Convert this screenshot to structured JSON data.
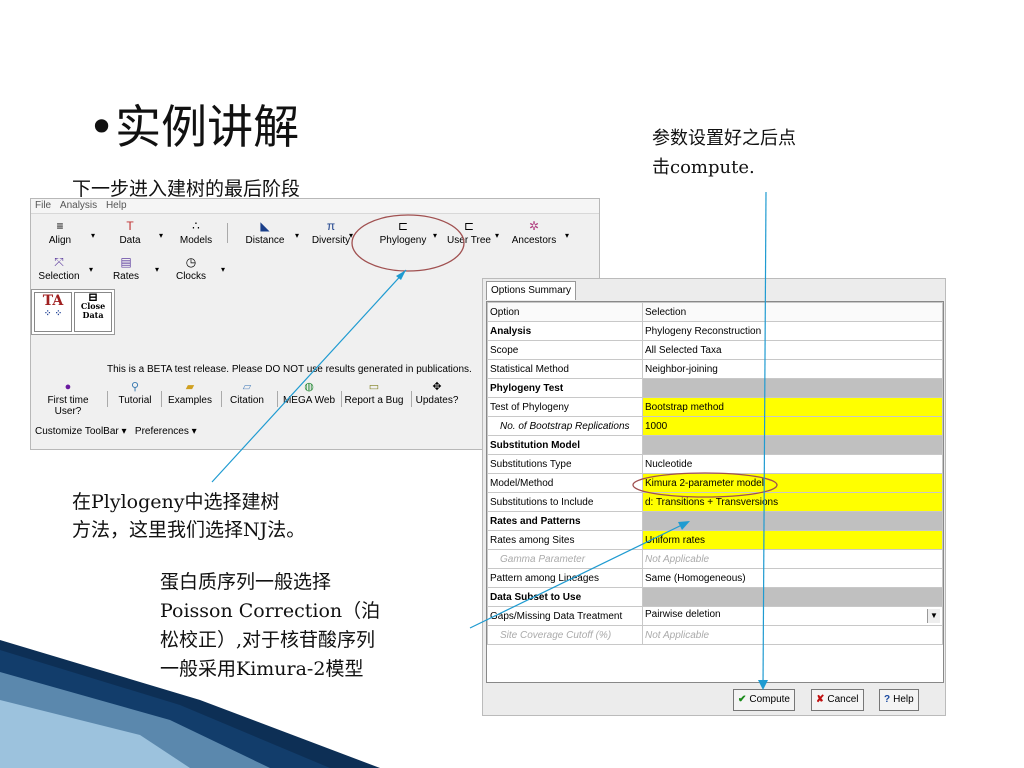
{
  "slide": {
    "title": "•实例讲解",
    "subtitle": "下一步进入建树的最后阶段",
    "note_right": [
      "参数设置好之后点",
      "击compute."
    ],
    "note_left": [
      "在Plylogeny中选择建树",
      "方法，这里我们选择NJ法。"
    ],
    "note_bottom": [
      "蛋白质序列一般选择",
      "Poisson Correction（泊",
      "松校正）,对于核苷酸序列",
      "一般采用Kimura-2模型"
    ]
  },
  "mega": {
    "menu": [
      "File",
      "Analysis",
      "Help"
    ],
    "toolbar_row1": [
      "Align",
      "Data",
      "Models",
      "Distance",
      "Diversity",
      "Phylogeny",
      "User Tree",
      "Ancestors"
    ],
    "toolbar_row2": [
      "Selection",
      "Rates",
      "Clocks"
    ],
    "close_data": "Close Data",
    "ta_label": "TA",
    "beta_notice": "This is a BETA test release. Please DO NOT use results generated in publications.",
    "links": [
      "First time User?",
      "Tutorial",
      "Examples",
      "Citation",
      "MEGA Web",
      "Report a Bug",
      "Updates?"
    ],
    "customize": "Customize ToolBar",
    "preferences": "Preferences"
  },
  "dialog": {
    "tab": "Options Summary",
    "header": {
      "option": "Option",
      "selection": "Selection"
    },
    "rows": [
      {
        "option": "Analysis",
        "selection": "Phylogeny Reconstruction",
        "kind": "bold"
      },
      {
        "option": "Scope",
        "selection": "All Selected Taxa",
        "kind": "normal"
      },
      {
        "option": "Statistical Method",
        "selection": "Neighbor-joining",
        "kind": "normal"
      },
      {
        "option": "Phylogeny Test",
        "selection": "",
        "kind": "section"
      },
      {
        "option": "Test of Phylogeny",
        "selection": "Bootstrap method",
        "kind": "yellow"
      },
      {
        "option": "No. of Bootstrap Replications",
        "selection": "1000",
        "kind": "yellow-ital"
      },
      {
        "option": "Substitution Model",
        "selection": "",
        "kind": "section"
      },
      {
        "option": "Substitutions Type",
        "selection": "Nucleotide",
        "kind": "normal"
      },
      {
        "option": "Model/Method",
        "selection": "Kimura 2-parameter model",
        "kind": "yellow"
      },
      {
        "option": "Substitutions to Include",
        "selection": "d: Transitions + Transversions",
        "kind": "yellow"
      },
      {
        "option": "Rates and Patterns",
        "selection": "",
        "kind": "section"
      },
      {
        "option": "Rates among Sites",
        "selection": "Uniform rates",
        "kind": "yellow"
      },
      {
        "option": "Gamma Parameter",
        "selection": "Not Applicable",
        "kind": "disabled"
      },
      {
        "option": "Pattern among Lineages",
        "selection": "Same (Homogeneous)",
        "kind": "normal"
      },
      {
        "option": "Data Subset to Use",
        "selection": "",
        "kind": "section"
      },
      {
        "option": "Gaps/Missing Data Treatment",
        "selection": "Pairwise deletion",
        "kind": "dropdown"
      },
      {
        "option": "Site Coverage Cutoff (%)",
        "selection": "Not Applicable",
        "kind": "disabled"
      }
    ],
    "buttons": {
      "compute": "Compute",
      "cancel": "Cancel",
      "help": "Help"
    },
    "colors": {
      "highlight": "#ffff00",
      "section": "#c0c0c0",
      "annotation": "#1f9bd1",
      "ellipse": "#a05050"
    }
  }
}
